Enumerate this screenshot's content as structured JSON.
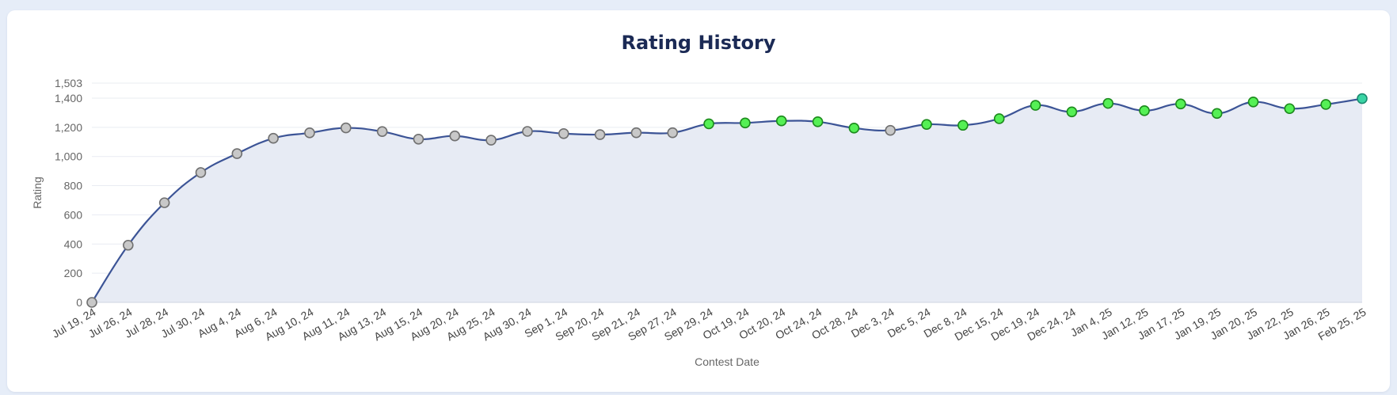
{
  "chart_data": {
    "type": "line",
    "title": "Rating History",
    "xlabel": "Contest Date",
    "ylabel": "Rating",
    "ylim": [
      0,
      1503
    ],
    "y_ticks": [
      "0",
      "200",
      "400",
      "600",
      "800",
      "1,000",
      "1,200",
      "1,400",
      "1,503"
    ],
    "grid": true,
    "categories": [
      "Jul 19, 24",
      "Jul 26, 24",
      "Jul 28, 24",
      "Jul 30, 24",
      "Aug 4, 24",
      "Aug 6, 24",
      "Aug 10, 24",
      "Aug 11, 24",
      "Aug 13, 24",
      "Aug 15, 24",
      "Aug 20, 24",
      "Aug 25, 24",
      "Aug 30, 24",
      "Sep 1, 24",
      "Sep 20, 24",
      "Sep 21, 24",
      "Sep 27, 24",
      "Sep 29, 24",
      "Oct 19, 24",
      "Oct 20, 24",
      "Oct 24, 24",
      "Oct 28, 24",
      "Dec 3, 24",
      "Dec 5, 24",
      "Dec 8, 24",
      "Dec 15, 24",
      "Dec 19, 24",
      "Dec 24, 24",
      "Jan 4, 25",
      "Jan 12, 25",
      "Jan 17, 25",
      "Jan 19, 25",
      "Jan 20, 25",
      "Jan 22, 25",
      "Jan 26, 25",
      "Feb 25, 25"
    ],
    "series": [
      {
        "values": [
          0,
          392,
          683,
          890,
          1020,
          1125,
          1162,
          1196,
          1171,
          1119,
          1141,
          1112,
          1172,
          1157,
          1150,
          1163,
          1163,
          1224,
          1230,
          1244,
          1238,
          1195,
          1179,
          1220,
          1214,
          1259,
          1351,
          1306,
          1364,
          1314,
          1360,
          1295,
          1374,
          1328,
          1357,
          1397
        ],
        "point_colors": [
          "gray",
          "gray",
          "gray",
          "gray",
          "gray",
          "gray",
          "gray",
          "gray",
          "gray",
          "gray",
          "gray",
          "gray",
          "gray",
          "gray",
          "gray",
          "gray",
          "gray",
          "green",
          "green",
          "green",
          "green",
          "green",
          "gray",
          "green",
          "green",
          "green",
          "green",
          "green",
          "green",
          "green",
          "green",
          "green",
          "green",
          "green",
          "green",
          "teal"
        ]
      }
    ],
    "colors": {
      "line": "#3c5496",
      "area": "#e7ebf4",
      "grid": "#e9ecf2",
      "gray_fill": "#c8c8c8",
      "gray_stroke": "#707070",
      "green_fill": "#55f055",
      "green_stroke": "#1c8a1c",
      "teal_fill": "#3ad4a4",
      "teal_stroke": "#1b8a70"
    }
  }
}
